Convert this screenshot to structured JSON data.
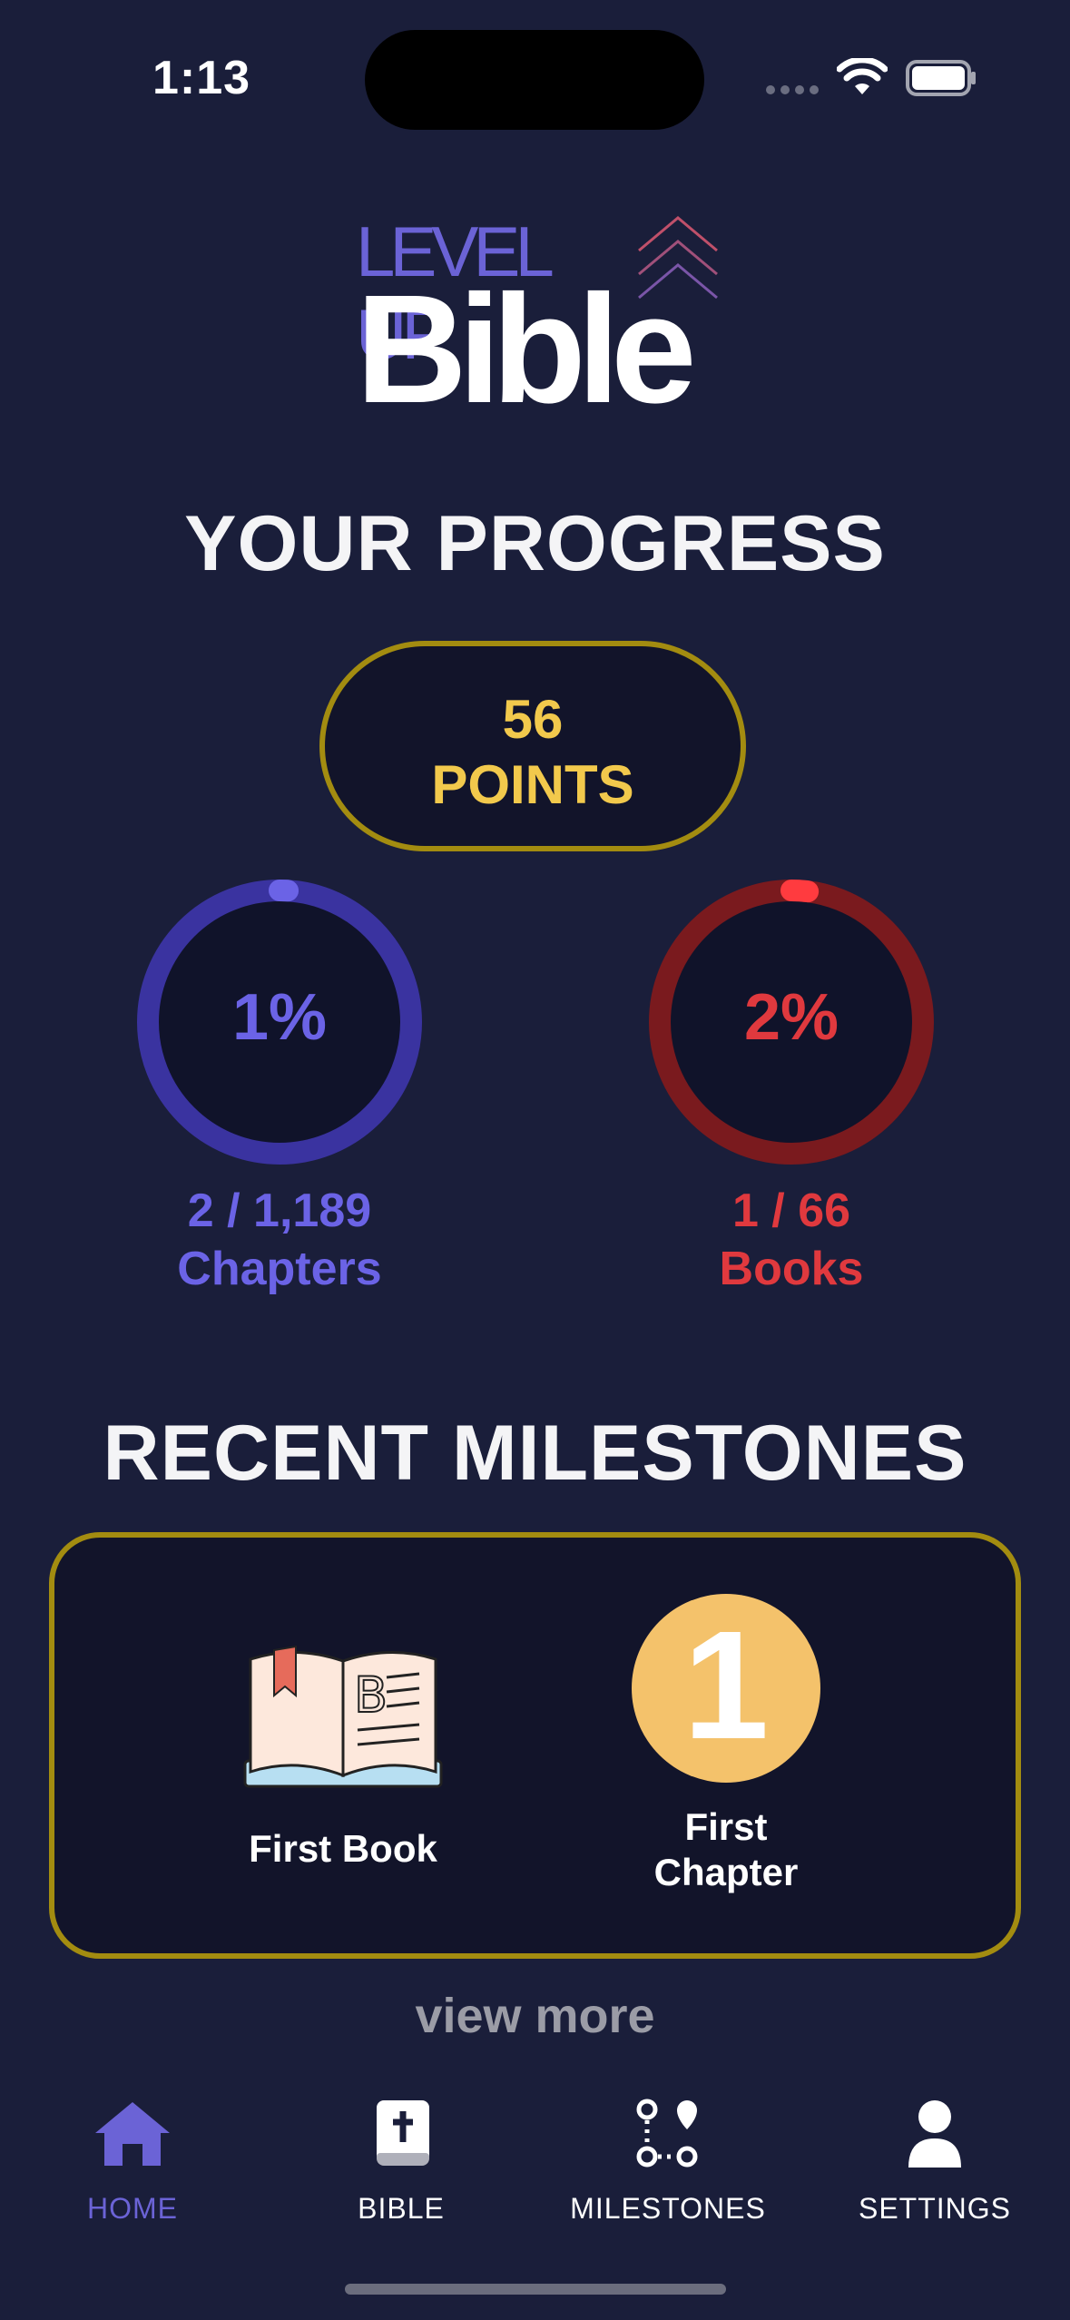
{
  "status_bar": {
    "time": "1:13"
  },
  "logo": {
    "line1": "LEVEL UP",
    "line2": "Bible"
  },
  "progress": {
    "title": "YOUR PROGRESS",
    "points_value": "56",
    "points_label": "POINTS",
    "chapters": {
      "percent_text": "1%",
      "percent": 1,
      "count": "2 / 1,189",
      "label": "Chapters",
      "color": "#6b63e6",
      "track_color": "#3a33a0"
    },
    "books": {
      "percent_text": "2%",
      "percent": 2,
      "count": "1 / 66",
      "label": "Books",
      "color": "#e0393e",
      "track_color": "#7a1a1e"
    }
  },
  "milestones": {
    "title": "RECENT MILESTONES",
    "items": [
      {
        "label": "First Book",
        "icon": "open-book-icon"
      },
      {
        "label_line1": "First",
        "label_line2": "Chapter",
        "badge": "1",
        "icon": "number-one-badge"
      }
    ],
    "view_more": "view more"
  },
  "tabbar": {
    "items": [
      {
        "label": "HOME",
        "icon": "home-icon",
        "active": true
      },
      {
        "label": "BIBLE",
        "icon": "bible-icon",
        "active": false
      },
      {
        "label": "MILESTONES",
        "icon": "route-icon",
        "active": false
      },
      {
        "label": "SETTINGS",
        "icon": "user-icon",
        "active": false
      }
    ],
    "active_color": "#6b63d6",
    "inactive_color": "#ffffff"
  }
}
